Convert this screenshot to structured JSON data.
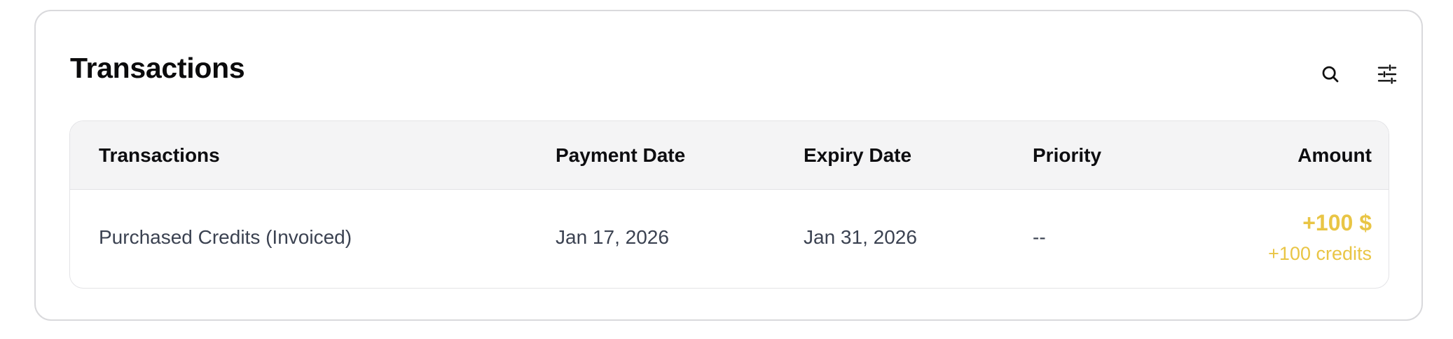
{
  "card": {
    "title": "Transactions",
    "icons": [
      "search-icon",
      "sliders-icon"
    ]
  },
  "table": {
    "columns": [
      "Transactions",
      "Payment Date",
      "Expiry Date",
      "Priority",
      "Amount"
    ],
    "rows": [
      {
        "transaction": "Purchased Credits (Invoiced)",
        "payment_date": "Jan 17, 2026",
        "expiry_date": "Jan 31, 2026",
        "priority": "--",
        "amount": "+100 $",
        "credits": "+100 credits"
      }
    ]
  },
  "colors": {
    "amount": "#e9c545",
    "header_bg": "#f4f4f5",
    "border": "#d9d9dc"
  }
}
